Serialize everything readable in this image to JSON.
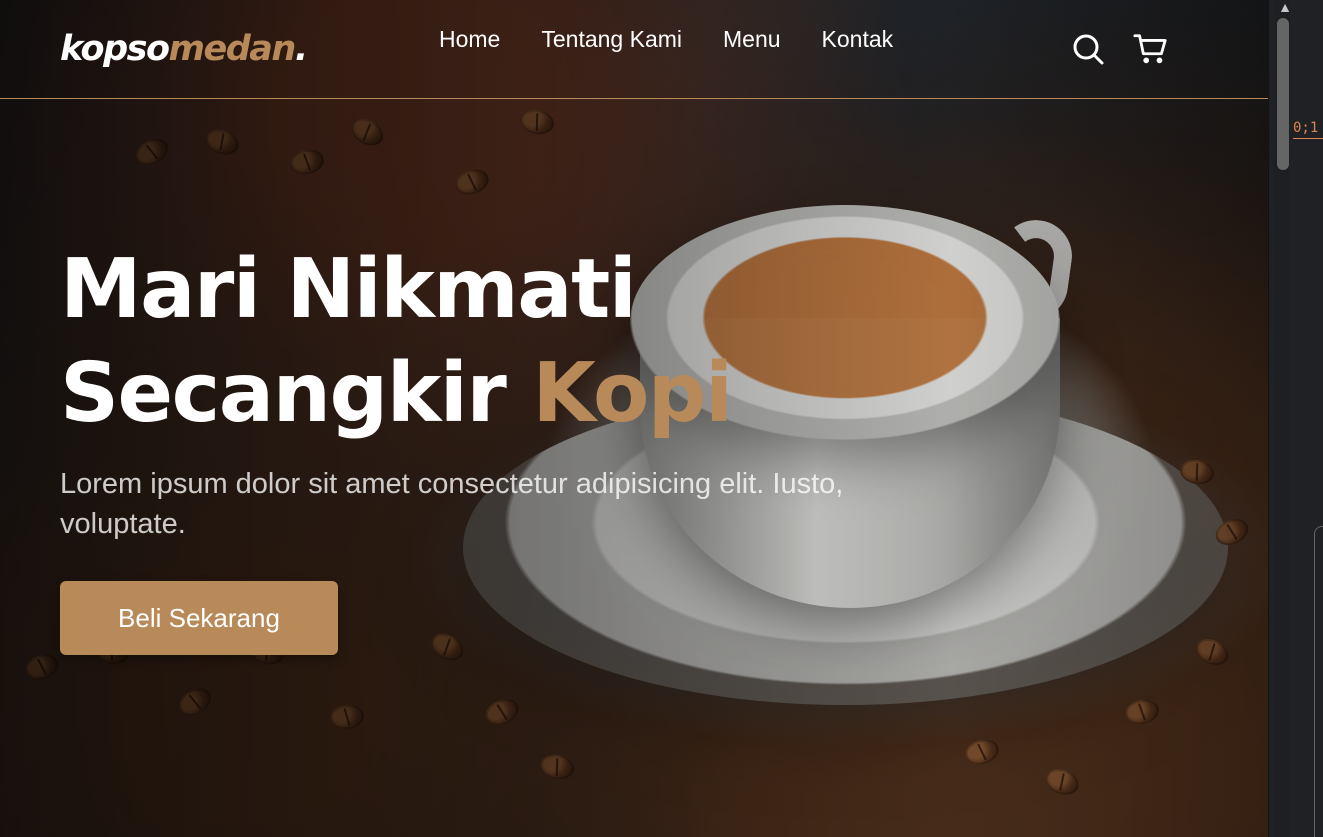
{
  "brand": {
    "primary": "kopso",
    "accent": "medan",
    "suffix": "."
  },
  "nav": {
    "links": [
      "Home",
      "Tentang Kami",
      "Menu",
      "Kontak"
    ]
  },
  "icons": {
    "search": "search-icon",
    "cart": "cart-icon"
  },
  "hero": {
    "title_line1": "Mari Nikmati",
    "title_line2_main": "Secangkir",
    "title_line2_accent": "Kopi",
    "description": "Lorem ipsum dolor sit amet consectetur adipisicing elit. Iusto, voluptate.",
    "cta": "Beli Sekarang"
  },
  "side_panel": {
    "code_text": "0;1"
  },
  "colors": {
    "accent": "#b88a5a",
    "text": "#ffffff"
  }
}
